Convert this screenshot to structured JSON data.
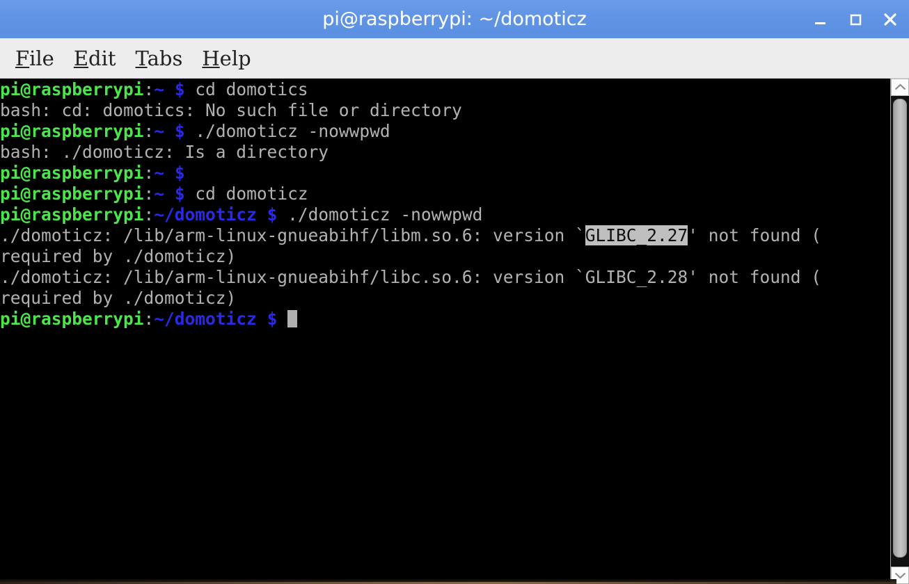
{
  "window": {
    "title": "pi@raspberrypi: ~/domoticz",
    "accent_color": "#5f93e3",
    "terminal_bg": "#000000",
    "menubar_bg": "#ededed"
  },
  "titlebar_buttons": [
    {
      "name": "minimize",
      "label": "_"
    },
    {
      "name": "maximize",
      "label": "□"
    },
    {
      "name": "close",
      "label": "×"
    }
  ],
  "menubar": {
    "items": [
      {
        "mnemonic": "F",
        "rest": "ile"
      },
      {
        "mnemonic": "E",
        "rest": "dit"
      },
      {
        "mnemonic": "T",
        "rest": "abs"
      },
      {
        "mnemonic": "H",
        "rest": "elp"
      }
    ]
  },
  "terminal": {
    "colors": {
      "prompt_user": "#4ee44e",
      "prompt_path": "#2a2ae6",
      "text": "#b2b2b2",
      "selection_bg": "#bfbfbf",
      "selection_fg": "#101010",
      "cursor": "#b0b0b0"
    },
    "lines": [
      {
        "id": "line-1",
        "segments": [
          {
            "class": "c-green",
            "text": "pi@raspberrypi"
          },
          {
            "class": "c-white",
            "text": ":"
          },
          {
            "class": "c-blue",
            "text": "~"
          },
          {
            "class": "c-white",
            "text": " "
          },
          {
            "class": "c-blue",
            "text": "$"
          },
          {
            "class": "c-plain",
            "text": " cd domotics"
          }
        ]
      },
      {
        "id": "line-2",
        "segments": [
          {
            "class": "c-plain",
            "text": "bash: cd: domotics: No such file or directory"
          }
        ]
      },
      {
        "id": "line-3",
        "segments": [
          {
            "class": "c-green",
            "text": "pi@raspberrypi"
          },
          {
            "class": "c-white",
            "text": ":"
          },
          {
            "class": "c-blue",
            "text": "~"
          },
          {
            "class": "c-white",
            "text": " "
          },
          {
            "class": "c-blue",
            "text": "$"
          },
          {
            "class": "c-plain",
            "text": " ./domoticz -nowwpwd"
          }
        ]
      },
      {
        "id": "line-4",
        "segments": [
          {
            "class": "c-plain",
            "text": "bash: ./domoticz: Is a directory"
          }
        ]
      },
      {
        "id": "line-5",
        "segments": [
          {
            "class": "c-green",
            "text": "pi@raspberrypi"
          },
          {
            "class": "c-white",
            "text": ":"
          },
          {
            "class": "c-blue",
            "text": "~"
          },
          {
            "class": "c-white",
            "text": " "
          },
          {
            "class": "c-blue",
            "text": "$"
          }
        ]
      },
      {
        "id": "line-6",
        "segments": [
          {
            "class": "c-green",
            "text": "pi@raspberrypi"
          },
          {
            "class": "c-white",
            "text": ":"
          },
          {
            "class": "c-blue",
            "text": "~"
          },
          {
            "class": "c-white",
            "text": " "
          },
          {
            "class": "c-blue",
            "text": "$"
          },
          {
            "class": "c-plain",
            "text": " cd domoticz"
          }
        ]
      },
      {
        "id": "line-7",
        "segments": [
          {
            "class": "c-green",
            "text": "pi@raspberrypi"
          },
          {
            "class": "c-white",
            "text": ":"
          },
          {
            "class": "c-blue",
            "text": "~/domoticz"
          },
          {
            "class": "c-white",
            "text": " "
          },
          {
            "class": "c-blue",
            "text": "$"
          },
          {
            "class": "c-plain",
            "text": " ./domoticz -nowwpwd"
          }
        ]
      },
      {
        "id": "line-8",
        "segments": [
          {
            "class": "c-plain",
            "text": "./domoticz: /lib/arm-linux-gnueabihf/libm.so.6: version `"
          },
          {
            "class": "c-sel",
            "text": "GLIBC_2.27"
          },
          {
            "class": "c-plain",
            "text": "' not found ("
          }
        ]
      },
      {
        "id": "line-9",
        "segments": [
          {
            "class": "c-plain",
            "text": "required by ./domoticz)"
          }
        ]
      },
      {
        "id": "line-10",
        "segments": [
          {
            "class": "c-plain",
            "text": "./domoticz: /lib/arm-linux-gnueabihf/libc.so.6: version `GLIBC_2.28' not found ("
          }
        ]
      },
      {
        "id": "line-11",
        "segments": [
          {
            "class": "c-plain",
            "text": "required by ./domoticz)"
          }
        ]
      },
      {
        "id": "line-12",
        "segments": [
          {
            "class": "c-green",
            "text": "pi@raspberrypi"
          },
          {
            "class": "c-white",
            "text": ":"
          },
          {
            "class": "c-blue",
            "text": "~/domoticz"
          },
          {
            "class": "c-white",
            "text": " "
          },
          {
            "class": "c-blue",
            "text": "$"
          },
          {
            "class": "c-plain",
            "text": " "
          },
          {
            "class": "cursor",
            "text": ""
          }
        ]
      }
    ]
  },
  "scrollbar": {
    "up_arrow": "▲",
    "down_arrow": "▼"
  }
}
